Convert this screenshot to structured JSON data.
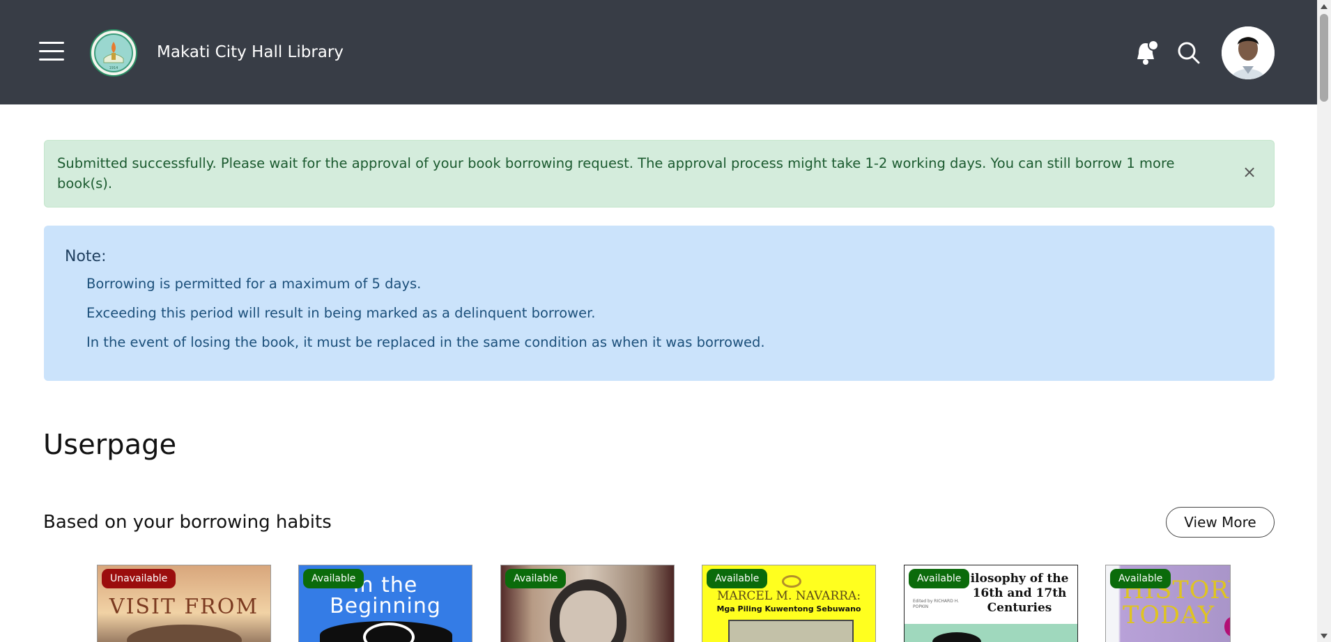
{
  "header": {
    "brand": "Makati City Hall Library",
    "icons": [
      "hamburger-menu-icon",
      "library-logo",
      "bell-icon",
      "search-icon",
      "user-avatar"
    ]
  },
  "alert_success": {
    "message": "Submitted successfully. Please wait for the approval of your book borrowing request. The approval process might take 1-2 working days. You can still borrow 1 more book(s).",
    "close_label": "×"
  },
  "note": {
    "title": "Note:",
    "items": [
      "Borrowing is permitted for a maximum of 5 days.",
      "Exceeding this period will result in being marked as a delinquent borrower.",
      "In the event of losing the book, it must be replaced in the same condition as when it was borrowed."
    ]
  },
  "page": {
    "title": "Userpage"
  },
  "recommendations": {
    "title": "Based on your borrowing habits",
    "view_more_label": "View More",
    "books": [
      {
        "status": "Unavailable",
        "cover_text": "VISIT FROM"
      },
      {
        "status": "Available",
        "cover_text": "In the Beginning"
      },
      {
        "status": "Available",
        "cover_text": ""
      },
      {
        "status": "Available",
        "cover_text": "MARCEL M. NAVARRA:",
        "cover_subtext": "Mga Piling Kuwentong Sebuwano"
      },
      {
        "status": "Available",
        "cover_text": "ilosophy of the 16th and 17th Centuries",
        "cover_subtext": "Edited by RICHARD H. POPKIN"
      },
      {
        "status": "Available",
        "cover_text": "HISTORY TODAY"
      }
    ]
  },
  "colors": {
    "navbar": "#383d46",
    "success_bg": "#d4ecdc",
    "info_bg": "#cbe3fb",
    "available_badge": "#0b6b0b",
    "unavailable_badge": "#9b0d0d"
  }
}
